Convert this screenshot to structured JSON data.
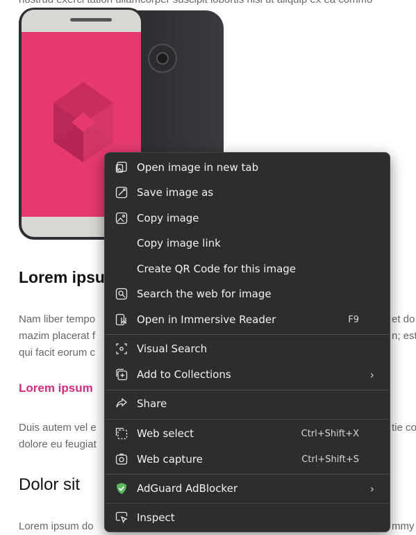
{
  "page": {
    "top_line": "nostrud exerci tation ullamcorper suscipit lobortis nisl ut aliquip ex ea commo",
    "heading1": "Lorem ipsu",
    "para1": [
      "Nam liber tempo",
      "mazim placerat f",
      "qui facit eorum c"
    ],
    "para1_right": [
      "et do",
      "n; est"
    ],
    "pink_link": "Lorem ipsum",
    "para2": [
      "Duis autem vel e",
      "dolore eu feugiat"
    ],
    "para2_right": "tie co",
    "heading2": "Dolor sit",
    "para3": "Lorem ipsum do",
    "para3_right": "mmy"
  },
  "colors": {
    "accent_pink": "#d42a7f",
    "screen_pink": "#e5396f",
    "menu_bg": "#2d2d2d",
    "adguard_green": "#5cb85c"
  },
  "context_menu": {
    "items": [
      {
        "label": "Open image in new tab",
        "icon": "open-image-new-tab-icon",
        "shortcut": ""
      },
      {
        "label": "Save image as",
        "icon": "save-image-icon",
        "shortcut": ""
      },
      {
        "label": "Copy image",
        "icon": "copy-image-icon",
        "shortcut": ""
      },
      {
        "label": "Copy image link",
        "icon": "",
        "shortcut": ""
      },
      {
        "label": "Create QR Code for this image",
        "icon": "",
        "shortcut": ""
      },
      {
        "label": "Search the web for image",
        "icon": "search-image-icon",
        "shortcut": ""
      },
      {
        "label": "Open in Immersive Reader",
        "icon": "immersive-reader-icon",
        "shortcut": "F9"
      },
      {
        "label": "Visual Search",
        "icon": "visual-search-icon",
        "shortcut": ""
      },
      {
        "label": "Add to Collections",
        "icon": "collections-icon",
        "shortcut": "",
        "submenu": true
      },
      {
        "label": "Share",
        "icon": "share-icon",
        "shortcut": ""
      },
      {
        "label": "Web select",
        "icon": "web-select-icon",
        "shortcut": "Ctrl+Shift+X"
      },
      {
        "label": "Web capture",
        "icon": "web-capture-icon",
        "shortcut": "Ctrl+Shift+S"
      },
      {
        "label": "AdGuard AdBlocker",
        "icon": "adguard-shield-icon",
        "shortcut": "",
        "submenu": true
      },
      {
        "label": "Inspect",
        "icon": "inspect-icon",
        "shortcut": ""
      }
    ],
    "submenu_glyph": "›"
  }
}
